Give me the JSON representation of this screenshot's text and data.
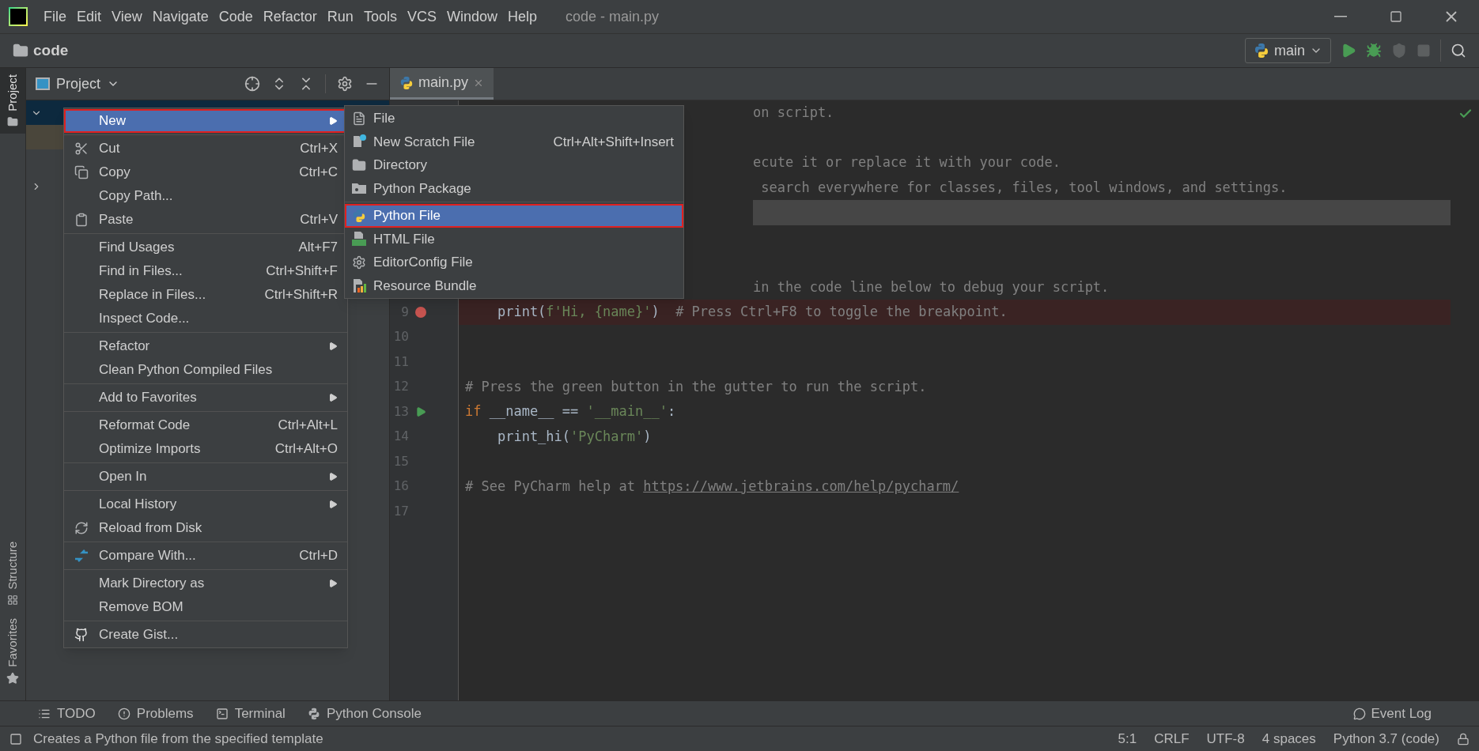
{
  "window": {
    "title": "code - main.py"
  },
  "menu_bar": [
    "File",
    "Edit",
    "View",
    "Navigate",
    "Code",
    "Refactor",
    "Run",
    "Tools",
    "VCS",
    "Window",
    "Help"
  ],
  "breadcrumb": "code",
  "run_config": {
    "label": "main"
  },
  "side_tabs": [
    {
      "label": "Project",
      "selected": true,
      "kind": "folder"
    },
    {
      "label": "Structure",
      "selected": false,
      "kind": "structure"
    },
    {
      "label": "Favorites",
      "selected": false,
      "kind": "star"
    }
  ],
  "project_panel": {
    "title": "Project"
  },
  "editor_tabs": [
    {
      "label": "main.py",
      "selected": true
    }
  ],
  "code_lines": [
    {
      "kind": "partial",
      "current": false,
      "segments": [
        {
          "kind": "comment",
          "text": "on script."
        }
      ]
    },
    {
      "kind": "partial",
      "current": false
    },
    {
      "kind": "partial",
      "current": false,
      "segments": [
        {
          "kind": "comment",
          "text": "ecute it or replace it with your code."
        }
      ]
    },
    {
      "kind": "partial",
      "current": false,
      "segments": [
        {
          "kind": "comment",
          "text": " search everywhere for classes, files, tool windows, and settings."
        }
      ]
    },
    {
      "kind": "partial",
      "current": true
    },
    {
      "kind": "partial",
      "current": false
    },
    {
      "kind": "partial",
      "current": false
    },
    {
      "kind": "partial",
      "current": false,
      "segments": [
        {
          "kind": "comment",
          "text": "in the code line below to debug your script."
        }
      ]
    },
    {
      "kind": "code",
      "number": "9",
      "current": false,
      "breakpoint": true,
      "run_marker": false,
      "segments": [
        {
          "kind": "plain",
          "text": "    print("
        },
        {
          "kind": "string",
          "text": "f'Hi, {name}'"
        },
        {
          "kind": "plain",
          "text": ")"
        },
        {
          "kind": "comment",
          "text": "  # Press Ctrl+F8 to toggle the breakpoint."
        }
      ]
    },
    {
      "kind": "code",
      "number": "10",
      "current": false,
      "breakpoint": false,
      "run_marker": false
    },
    {
      "kind": "code",
      "number": "11",
      "current": false,
      "breakpoint": false,
      "run_marker": false
    },
    {
      "kind": "code",
      "number": "12",
      "current": false,
      "breakpoint": false,
      "run_marker": false,
      "segments": [
        {
          "kind": "comment",
          "text": "# Press the green button in the gutter to run the script."
        }
      ]
    },
    {
      "kind": "code",
      "number": "13",
      "current": false,
      "breakpoint": false,
      "run_marker": true,
      "segments": [
        {
          "kind": "keyword",
          "text": "if"
        },
        {
          "kind": "plain",
          "text": " __name__ == "
        },
        {
          "kind": "string",
          "text": "'__main__'"
        },
        {
          "kind": "plain",
          "text": ":"
        }
      ]
    },
    {
      "kind": "code",
      "number": "14",
      "current": false,
      "breakpoint": false,
      "run_marker": false,
      "segments": [
        {
          "kind": "plain",
          "text": "    print_hi("
        },
        {
          "kind": "string",
          "text": "'PyCharm'"
        },
        {
          "kind": "plain",
          "text": ")"
        }
      ]
    },
    {
      "kind": "code",
      "number": "15",
      "current": false,
      "breakpoint": false,
      "run_marker": false
    },
    {
      "kind": "code",
      "number": "16",
      "current": false,
      "breakpoint": false,
      "run_marker": false,
      "segments": [
        {
          "kind": "comment",
          "text": "# See PyCharm help at "
        },
        {
          "kind": "link",
          "text": "https://www.jetbrains.com/help/pycharm/"
        }
      ]
    },
    {
      "kind": "code",
      "number": "17",
      "current": false,
      "breakpoint": false,
      "run_marker": false
    }
  ],
  "context_menu": {
    "groups": [
      {
        "items": [
          {
            "label": "New",
            "kind": "none",
            "submenu": true,
            "selected": true,
            "annotated": true
          }
        ]
      },
      {
        "items": [
          {
            "label": "Cut",
            "shortcut": "Ctrl+X",
            "kind": "cut",
            "submenu": false,
            "selected": false,
            "annotated": false
          },
          {
            "label": "Copy",
            "shortcut": "Ctrl+C",
            "kind": "copy",
            "submenu": false,
            "selected": false,
            "annotated": false
          },
          {
            "label": "Copy Path...",
            "kind": "none",
            "submenu": false,
            "selected": false,
            "annotated": false
          },
          {
            "label": "Paste",
            "shortcut": "Ctrl+V",
            "kind": "paste",
            "submenu": false,
            "selected": false,
            "annotated": false
          }
        ]
      },
      {
        "items": [
          {
            "label": "Find Usages",
            "shortcut": "Alt+F7",
            "kind": "none",
            "submenu": false,
            "selected": false,
            "annotated": false
          },
          {
            "label": "Find in Files...",
            "shortcut": "Ctrl+Shift+F",
            "kind": "none",
            "submenu": false,
            "selected": false,
            "annotated": false
          },
          {
            "label": "Replace in Files...",
            "shortcut": "Ctrl+Shift+R",
            "kind": "none",
            "submenu": false,
            "selected": false,
            "annotated": false
          },
          {
            "label": "Inspect Code...",
            "kind": "none",
            "submenu": false,
            "selected": false,
            "annotated": false
          }
        ]
      },
      {
        "items": [
          {
            "label": "Refactor",
            "kind": "none",
            "submenu": true,
            "selected": false,
            "annotated": false
          },
          {
            "label": "Clean Python Compiled Files",
            "kind": "none",
            "submenu": false,
            "selected": false,
            "annotated": false
          }
        ]
      },
      {
        "items": [
          {
            "label": "Add to Favorites",
            "kind": "none",
            "submenu": true,
            "selected": false,
            "annotated": false
          }
        ]
      },
      {
        "items": [
          {
            "label": "Reformat Code",
            "shortcut": "Ctrl+Alt+L",
            "kind": "none",
            "submenu": false,
            "selected": false,
            "annotated": false
          },
          {
            "label": "Optimize Imports",
            "shortcut": "Ctrl+Alt+O",
            "kind": "none",
            "submenu": false,
            "selected": false,
            "annotated": false
          }
        ]
      },
      {
        "items": [
          {
            "label": "Open In",
            "kind": "none",
            "submenu": true,
            "selected": false,
            "annotated": false
          }
        ]
      },
      {
        "items": [
          {
            "label": "Local History",
            "kind": "none",
            "submenu": true,
            "selected": false,
            "annotated": false
          },
          {
            "label": "Reload from Disk",
            "kind": "reload",
            "submenu": false,
            "selected": false,
            "annotated": false
          }
        ]
      },
      {
        "items": [
          {
            "label": "Compare With...",
            "shortcut": "Ctrl+D",
            "kind": "compare",
            "submenu": false,
            "selected": false,
            "annotated": false
          }
        ]
      },
      {
        "items": [
          {
            "label": "Mark Directory as",
            "kind": "none",
            "submenu": true,
            "selected": false,
            "annotated": false
          },
          {
            "label": "Remove BOM",
            "kind": "none",
            "submenu": false,
            "selected": false,
            "annotated": false
          }
        ]
      },
      {
        "items": [
          {
            "label": "Create Gist...",
            "kind": "github",
            "submenu": false,
            "selected": false,
            "annotated": false
          }
        ]
      }
    ]
  },
  "new_submenu": {
    "groups": [
      {
        "items": [
          {
            "label": "File",
            "kind": "file",
            "selected": false,
            "annotated": false
          },
          {
            "label": "New Scratch File",
            "shortcut": "Ctrl+Alt+Shift+Insert",
            "kind": "scratch",
            "selected": false,
            "annotated": false
          },
          {
            "label": "Directory",
            "kind": "folder",
            "selected": false,
            "annotated": false
          },
          {
            "label": "Python Package",
            "kind": "package",
            "selected": false,
            "annotated": false
          }
        ]
      },
      {
        "items": [
          {
            "label": "Python File",
            "kind": "python",
            "selected": true,
            "annotated": true
          },
          {
            "label": "HTML File",
            "kind": "html",
            "selected": false,
            "annotated": false
          },
          {
            "label": "EditorConfig File",
            "kind": "gear",
            "selected": false,
            "annotated": false
          },
          {
            "label": "Resource Bundle",
            "kind": "bundle",
            "selected": false,
            "annotated": false
          }
        ]
      }
    ]
  },
  "tool_windows": [
    {
      "label": "TODO",
      "kind": "list"
    },
    {
      "label": "Problems",
      "kind": "alert"
    },
    {
      "label": "Terminal",
      "kind": "terminal"
    },
    {
      "label": "Python Console",
      "kind": "python"
    }
  ],
  "event_log": "Event Log",
  "status_bar": {
    "message": "Creates a Python file from the specified template",
    "items": [
      "5:1",
      "CRLF",
      "UTF-8",
      "4 spaces",
      "Python 3.7 (code)"
    ]
  }
}
